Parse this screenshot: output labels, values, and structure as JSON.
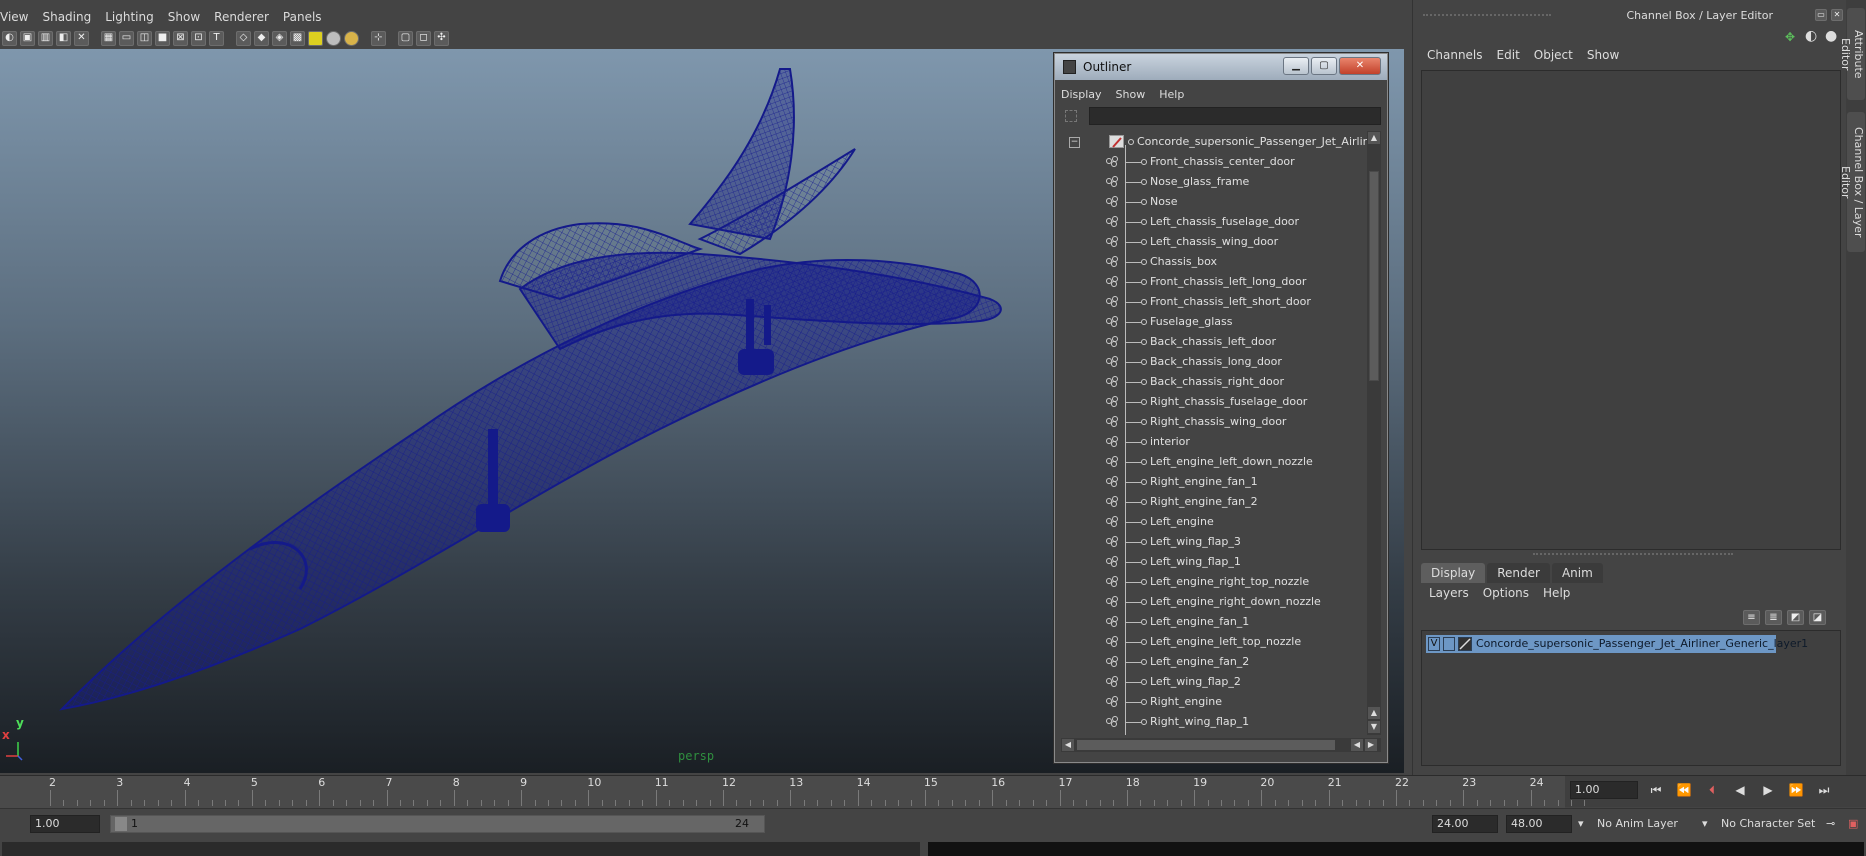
{
  "viewport": {
    "menus": [
      "View",
      "Shading",
      "Lighting",
      "Show",
      "Renderer",
      "Panels"
    ],
    "camera_label": "persp",
    "axis": {
      "x": "x",
      "y": "y"
    }
  },
  "outliner": {
    "title": "Outliner",
    "menus": [
      "Display",
      "Show",
      "Help"
    ],
    "root": "Concorde_supersonic_Passenger_Jet_Airliner",
    "items": [
      "Front_chassis_center_door",
      "Nose_glass_frame",
      "Nose",
      "Left_chassis_fuselage_door",
      "Left_chassis_wing_door",
      "Chassis_box",
      "Front_chassis_left_long_door",
      "Front_chassis_left_short_door",
      "Fuselage_glass",
      "Back_chassis_left_door",
      "Back_chassis_long_door",
      "Back_chassis_right_door",
      "Right_chassis_fuselage_door",
      "Right_chassis_wing_door",
      "interior",
      "Left_engine_left_down_nozzle",
      "Right_engine_fan_1",
      "Right_engine_fan_2",
      "Left_engine",
      "Left_wing_flap_3",
      "Left_wing_flap_1",
      "Left_engine_right_top_nozzle",
      "Left_engine_right_down_nozzle",
      "Left_engine_fan_1",
      "Left_engine_left_top_nozzle",
      "Left_engine_fan_2",
      "Left_wing_flap_2",
      "Right_engine",
      "Right_wing_flap_1"
    ]
  },
  "channel_box": {
    "title": "Channel Box / Layer Editor",
    "menus": [
      "Channels",
      "Edit",
      "Object",
      "Show"
    ],
    "layer_tabs": [
      "Display",
      "Render",
      "Anim"
    ],
    "active_layer_tab": "Display",
    "layer_menus": [
      "Layers",
      "Options",
      "Help"
    ],
    "layer": {
      "visible": "V",
      "name": "Concorde_supersonic_Passenger_Jet_Airliner_Generic_layer1"
    }
  },
  "side_tabs": [
    "Attribute Editor",
    "Channel Box / Layer Editor"
  ],
  "timeline": {
    "ticks": [
      "2",
      "3",
      "4",
      "5",
      "6",
      "7",
      "8",
      "9",
      "10",
      "11",
      "12",
      "13",
      "14",
      "15",
      "16",
      "17",
      "18",
      "19",
      "20",
      "21",
      "22",
      "23",
      "24"
    ],
    "current_frame": "1.00"
  },
  "range": {
    "start": "1.00",
    "slider_start": "1",
    "slider_end": "24",
    "end": "24.00",
    "total_end": "48.00",
    "anim_layer": "No Anim Layer",
    "character_set": "No Character Set"
  },
  "colors": {
    "wireframe": "#141a8a",
    "layer_highlight": "#6d97c5",
    "camera_label": "#2f8f3f"
  }
}
